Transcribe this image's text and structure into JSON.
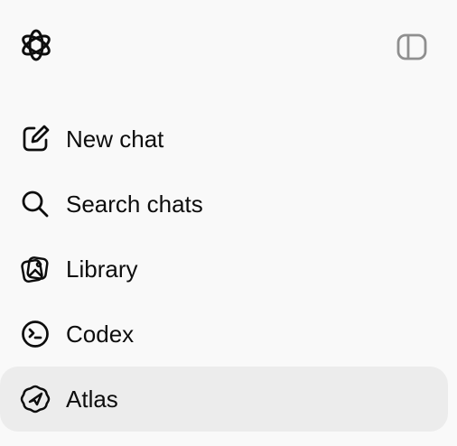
{
  "header": {
    "logo_icon": "openai-logo-icon",
    "toggle_icon": "sidebar-toggle-icon"
  },
  "nav": {
    "items": [
      {
        "label": "New chat",
        "icon": "edit-icon"
      },
      {
        "label": "Search chats",
        "icon": "search-icon"
      },
      {
        "label": "Library",
        "icon": "images-icon"
      },
      {
        "label": "Codex",
        "icon": "codex-icon"
      },
      {
        "label": "Atlas",
        "icon": "compass-icon"
      }
    ],
    "active_index": 4
  },
  "colors": {
    "background": "#f9f9f9",
    "active_row": "#ececec",
    "text": "#0d0d0d",
    "muted_icon": "#8f8f8f"
  }
}
